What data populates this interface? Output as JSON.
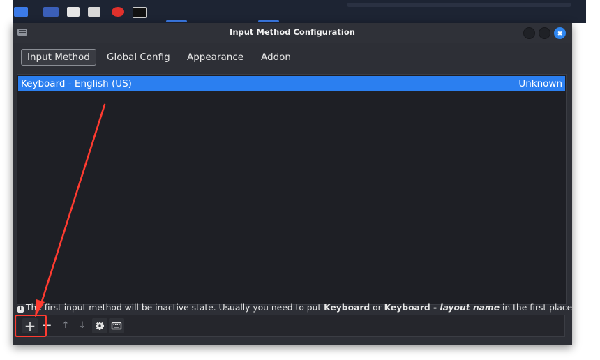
{
  "window": {
    "title": "Input Method Configuration",
    "close_icon": "✖"
  },
  "tabs": [
    {
      "label": "Input Method",
      "active": true
    },
    {
      "label": "Global Config",
      "active": false
    },
    {
      "label": "Appearance",
      "active": false
    },
    {
      "label": "Addon",
      "active": false
    }
  ],
  "input_methods": [
    {
      "name": "Keyboard - English (US)",
      "status": "Unknown",
      "selected": true
    }
  ],
  "info": {
    "icon": "i",
    "text_before": "The first input method will be inactive state. Usually you need to put ",
    "keyword_1": "Keyboard",
    "text_or": " or ",
    "keyword_2": "Keyboard - ",
    "keyword_italic": "layout name",
    "text_after": " in the first place."
  },
  "toolbar": {
    "add_label": "+",
    "remove_label": "−",
    "up_label": "↑",
    "down_label": "↓",
    "configure_icon": "gear-icon",
    "keyboard_icon": "keyboard-icon"
  },
  "colors": {
    "accent": "#2b7ff0",
    "window_bg": "#2d2f36",
    "list_bg": "#1e1f25",
    "annotation": "#ff3b30"
  }
}
